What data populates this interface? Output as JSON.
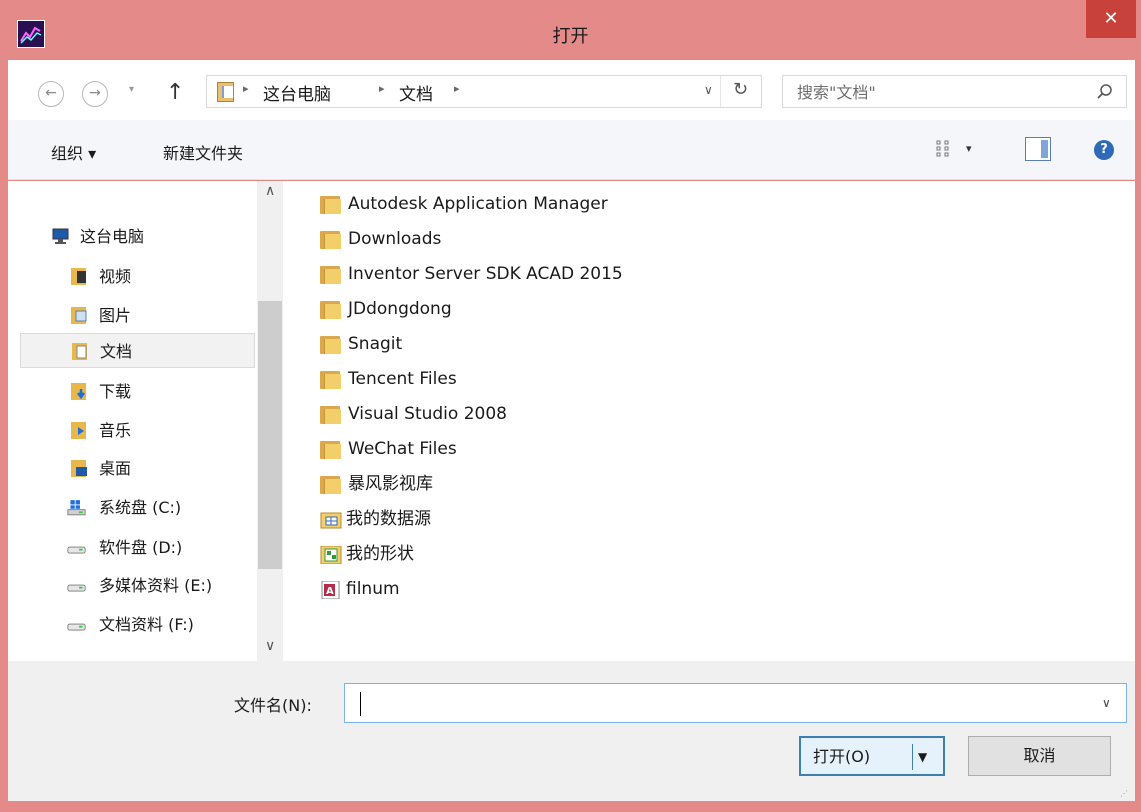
{
  "window": {
    "title": "打开",
    "close_glyph": "✕"
  },
  "navbar": {
    "back_glyph": "←",
    "forward_glyph": "→",
    "recent_glyph": "▾",
    "up_glyph": "↑",
    "breadcrumb": [
      "这台电脑",
      "文档"
    ],
    "sep_glyph": "▸",
    "dropdown_glyph": "∨",
    "refresh_glyph": "↻",
    "search_placeholder": "搜索\"文档\""
  },
  "toolbar": {
    "organize_label": "组织 ▾",
    "new_folder_label": "新建文件夹",
    "view_dropdown_glyph": "▾",
    "help_glyph": "?"
  },
  "nav_pane": {
    "scroll_up_glyph": "∧",
    "scroll_down_glyph": "∨",
    "items": [
      {
        "label": "这台电脑",
        "icon": "computer-icon",
        "selected": false
      },
      {
        "label": "视频",
        "icon": "videos-folder-icon",
        "selected": false
      },
      {
        "label": "图片",
        "icon": "pictures-folder-icon",
        "selected": false
      },
      {
        "label": "文档",
        "icon": "documents-folder-icon",
        "selected": true
      },
      {
        "label": "下载",
        "icon": "downloads-folder-icon",
        "selected": false
      },
      {
        "label": "音乐",
        "icon": "music-folder-icon",
        "selected": false
      },
      {
        "label": "桌面",
        "icon": "desktop-folder-icon",
        "selected": false
      },
      {
        "label": "系统盘 (C:)",
        "icon": "system-drive-icon",
        "selected": false
      },
      {
        "label": "软件盘 (D:)",
        "icon": "drive-icon",
        "selected": false
      },
      {
        "label": "多媒体资料 (E:)",
        "icon": "drive-icon",
        "selected": false
      },
      {
        "label": "文档资料 (F:)",
        "icon": "drive-icon",
        "selected": false
      }
    ]
  },
  "files": [
    {
      "name": "Autodesk Application Manager",
      "icon": "folder-icon"
    },
    {
      "name": "Downloads",
      "icon": "folder-icon"
    },
    {
      "name": "Inventor Server SDK ACAD 2015",
      "icon": "folder-icon"
    },
    {
      "name": "JDdongdong",
      "icon": "folder-icon"
    },
    {
      "name": "Snagit",
      "icon": "folder-icon"
    },
    {
      "name": "Tencent Files",
      "icon": "folder-icon"
    },
    {
      "name": "Visual Studio 2008",
      "icon": "folder-icon"
    },
    {
      "name": "WeChat Files",
      "icon": "folder-icon"
    },
    {
      "name": "暴风影视库",
      "icon": "folder-icon"
    },
    {
      "name": "我的数据源",
      "icon": "data-source-icon"
    },
    {
      "name": "我的形状",
      "icon": "shapes-icon"
    },
    {
      "name": "filnum",
      "icon": "access-file-icon"
    }
  ],
  "bottom": {
    "filename_label": "文件名(N):",
    "filename_value": "",
    "filename_dropdown_glyph": "∨",
    "open_label": "打开(O)",
    "open_arrow_glyph": "▼",
    "cancel_label": "取消",
    "grip_glyph": "⋰"
  },
  "colors": {
    "titlebar": "#e48a88",
    "close_button": "#c8413a",
    "accent": "#3c7fb1"
  }
}
